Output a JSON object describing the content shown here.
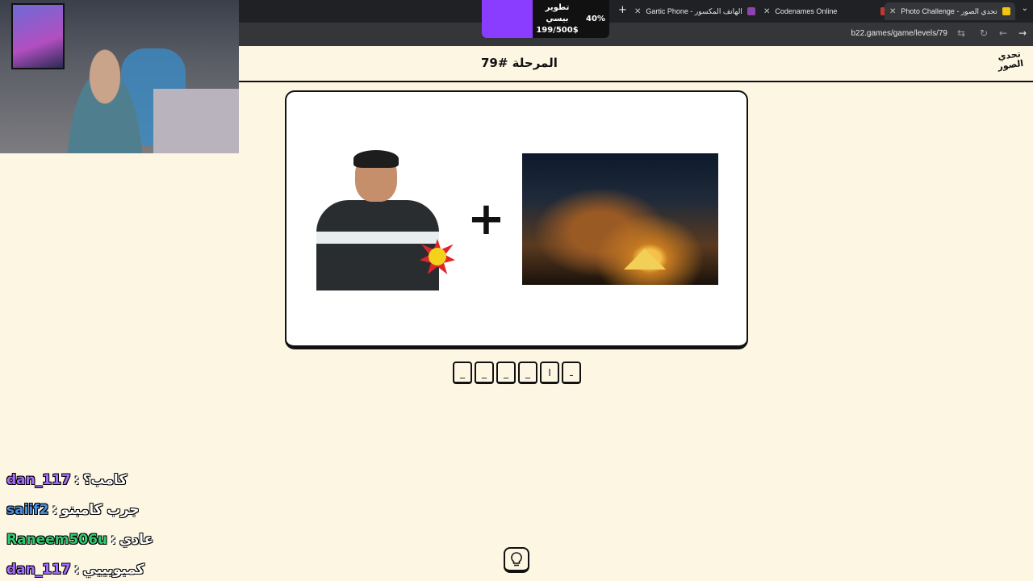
{
  "browser": {
    "tabs": [
      {
        "label": "Gartic Phone - الهاتف المكسور",
        "icon": "phone-icon",
        "color": "#8e44ad"
      },
      {
        "label": "Codenames Online",
        "icon": "codenames-icon",
        "color": "#c0392b"
      },
      {
        "label": "Photo Challenge - تحدي الصور",
        "icon": "photo-challenge-icon",
        "color": "#f1c40f",
        "active": true
      }
    ],
    "url": "b22.games/game/levels/79"
  },
  "donation": {
    "title": "تطوير بيسي",
    "amount": "199/500$",
    "percent": "40%",
    "progress": 0.4,
    "color": "#8b3dff"
  },
  "site": {
    "level_title": "المرحلة #79",
    "logo_text": "تحدي الصور"
  },
  "puzzle": {
    "operator": "+",
    "slots": [
      "_",
      "_",
      "_",
      "_",
      "ا",
      "ـ"
    ]
  },
  "chat": [
    {
      "user": "dan_117",
      "color": "#a66cff",
      "text": "كامب؟"
    },
    {
      "user": "saiif2",
      "color": "#4a90e2",
      "text": "جرب كامبنو"
    },
    {
      "user": "Raneem506u",
      "color": "#2ecc71",
      "text": "عادي"
    },
    {
      "user": "dan_117",
      "color": "#a66cff",
      "text": "كمبوبييي"
    }
  ],
  "hint": {
    "icon": "lightbulb-icon"
  }
}
